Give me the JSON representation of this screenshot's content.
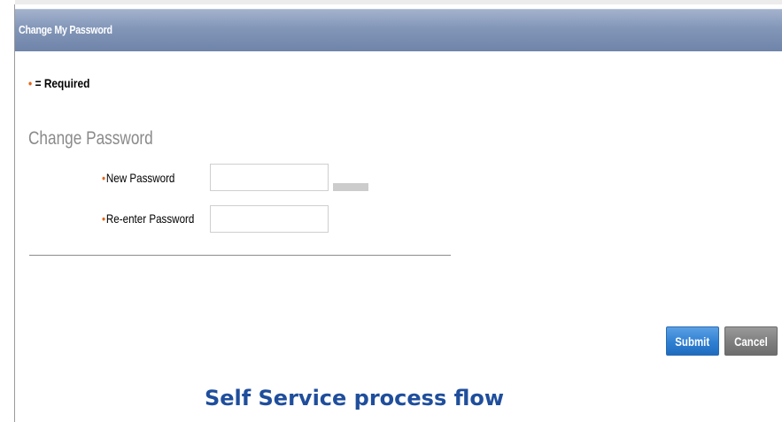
{
  "header": {
    "title": "Change My Password"
  },
  "required_note": {
    "bullet": "•",
    "text": "= Required"
  },
  "form": {
    "section_title": "Change Password",
    "new_password": {
      "bullet": "•",
      "label": "New Password",
      "value": ""
    },
    "reenter_password": {
      "bullet": "•",
      "label": "Re-enter Password",
      "value": ""
    }
  },
  "actions": {
    "submit_label": "Submit",
    "cancel_label": "Cancel"
  },
  "caption": "Self Service process flow",
  "colors": {
    "header": "#8296b8",
    "required_bullet": "#e2661b",
    "submit": "#2f7fd2",
    "cancel": "#7e7e7e",
    "caption": "#1f4e9c"
  }
}
